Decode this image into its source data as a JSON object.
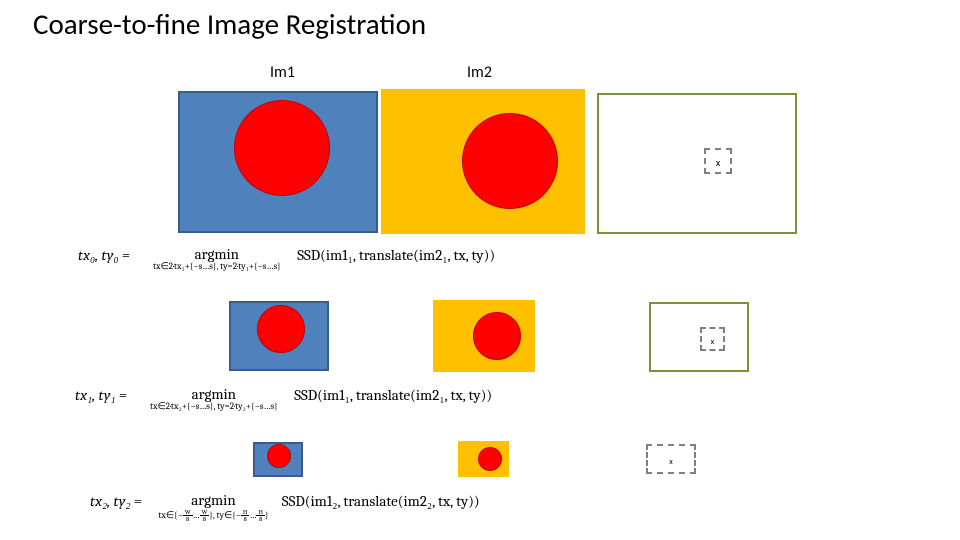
{
  "title": "Coarse-to-fine Image Registration",
  "labels": {
    "im1": "Im1",
    "im2": "Im2"
  },
  "markers": {
    "x0": "x",
    "x1": "x",
    "x2": "x"
  },
  "eq0": {
    "lhs": "tx₀, ty₀ =",
    "op_top": "argmin",
    "op_sub": "tx∈2·tx₁+{−s…s}, ty=2·ty₁+{−s…s}",
    "rhs": "SSD(im1₁, translate(im2₁, tx, ty))"
  },
  "eq1": {
    "lhs": "tx₁, ty₁ =",
    "op_top": "argmin",
    "op_sub": "tx∈2·tx₂+{−s…s}, ty=2·ty₂+{−s…s}",
    "rhs": "SSD(im1₁, translate(im2₁, tx, ty))"
  },
  "eq2": {
    "lhs": "tx₂, ty₂ =",
    "op_top": "argmin",
    "op_sub_a": "tx∈{−",
    "op_sub_b": "…",
    "op_sub_c": "}, ty∈{−",
    "op_sub_d": "…",
    "op_sub_e": "}",
    "rhs": "SSD(im1₂, translate(im2₂, tx, ty))"
  }
}
